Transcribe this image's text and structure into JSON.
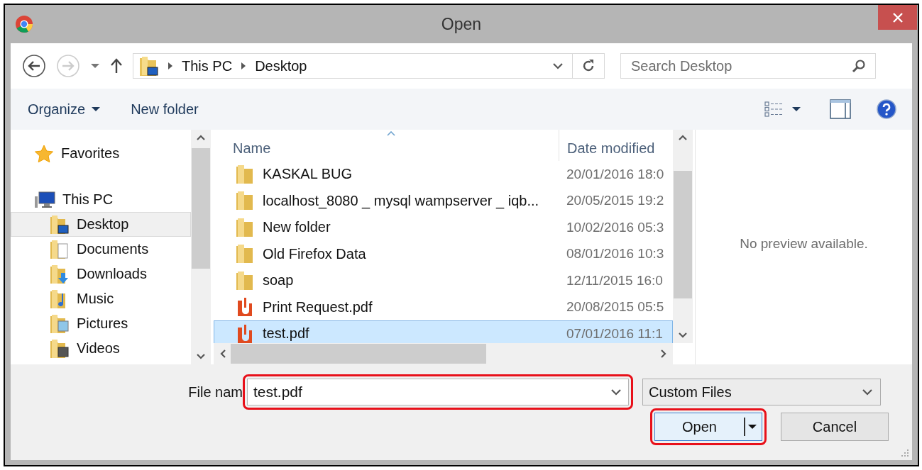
{
  "window": {
    "title": "Open"
  },
  "navigation": {
    "breadcrumb": [
      "This PC",
      "Desktop"
    ],
    "search": {
      "placeholder": "Search Desktop"
    }
  },
  "toolbar": {
    "organize": "Organize",
    "new_folder": "New folder"
  },
  "sidebar": {
    "items": [
      {
        "label": "Favorites",
        "kind": "favorites",
        "selected": false
      },
      {
        "label": "This PC",
        "kind": "computer",
        "selected": false,
        "children": [
          {
            "label": "Desktop",
            "kind": "desktop",
            "selected": true
          },
          {
            "label": "Documents",
            "kind": "documents",
            "selected": false
          },
          {
            "label": "Downloads",
            "kind": "downloads",
            "selected": false
          },
          {
            "label": "Music",
            "kind": "music",
            "selected": false
          },
          {
            "label": "Pictures",
            "kind": "pictures",
            "selected": false
          },
          {
            "label": "Videos",
            "kind": "videos",
            "selected": false
          }
        ]
      }
    ]
  },
  "files": {
    "columns": [
      "Name",
      "Date modified"
    ],
    "rows": [
      {
        "name": "KASKAL BUG",
        "kind": "folder",
        "date": "20/01/2016 18:0",
        "selected": false
      },
      {
        "name": "localhost_8080 _ mysql wampserver _ iqb...",
        "kind": "folder",
        "date": "20/05/2015 19:2",
        "selected": false
      },
      {
        "name": "New folder",
        "kind": "folder",
        "date": "10/02/2016 05:3",
        "selected": false
      },
      {
        "name": "Old Firefox Data",
        "kind": "folder",
        "date": "08/01/2016 10:3",
        "selected": false
      },
      {
        "name": "soap",
        "kind": "folder",
        "date": "12/11/2015 16:0",
        "selected": false
      },
      {
        "name": "Print Request.pdf",
        "kind": "pdf",
        "date": "20/08/2015 05:5",
        "selected": false
      },
      {
        "name": "test.pdf",
        "kind": "pdf",
        "date": "07/01/2016 11:1",
        "selected": true
      }
    ]
  },
  "preview": {
    "message": "No preview available."
  },
  "footer": {
    "file_name_label": "File nam",
    "file_name": {
      "value": "test.pdf",
      "highlighted": true
    },
    "file_type": "Custom Files",
    "buttons": [
      {
        "label": "Open",
        "kind": "split",
        "highlighted": true
      },
      {
        "label": "Cancel",
        "kind": "plain",
        "highlighted": false
      }
    ]
  }
}
